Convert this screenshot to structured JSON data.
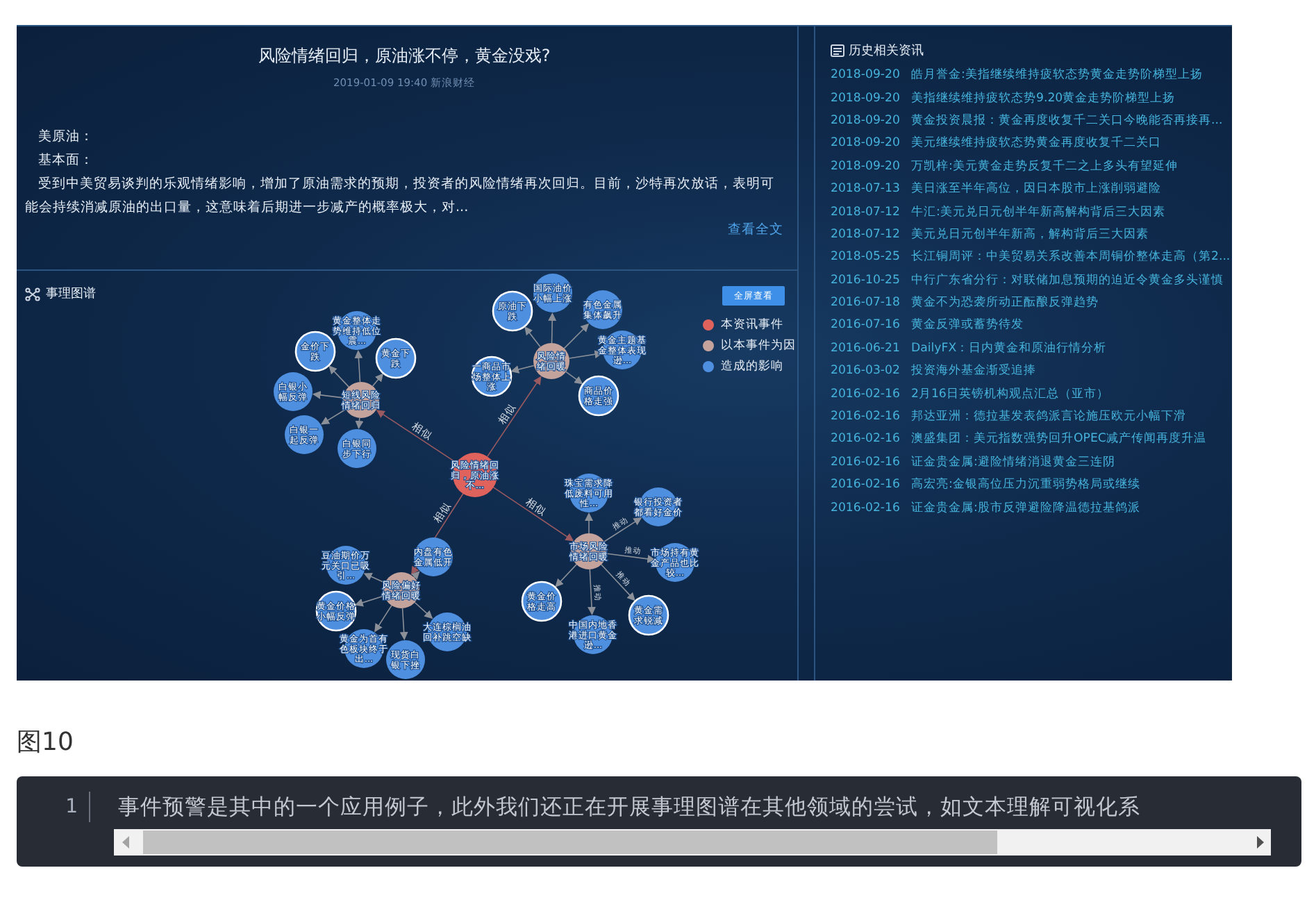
{
  "article": {
    "title": "风险情绪回归，原油涨不停，黄金没戏?",
    "meta": "2019-01-09 19:40 新浪财经",
    "lines": [
      "美原油：",
      "基本面：",
      "受到中美贸易谈判的乐观情绪影响，增加了原油需求的预期，投资者的风险情绪再次回归。目前，沙特再次放话，表明可能会持续消减原油的出口量，这意味着后期进一步减产的概率极大，对..."
    ],
    "read_more": "查看全文"
  },
  "graph": {
    "title": "事理图谱",
    "fullscreen_button": "全屏查看",
    "legend": [
      {
        "kind": "event",
        "label": "本资讯事件",
        "color": "#e0625c"
      },
      {
        "kind": "cause",
        "label": "以本事件为因",
        "color": "#c4a39c"
      },
      {
        "kind": "effect",
        "label": "造成的影响",
        "color": "#4f8fe0"
      }
    ],
    "root": {
      "label": "风险情绪回归，原油涨不...",
      "kind": "event",
      "children": [
        {
          "label": "短线风险情绪回归",
          "kind": "cause",
          "relation": "相似",
          "children": [
            {
              "label": "黄金整体走势维持低位震...",
              "kind": "effect",
              "highlighted": false
            },
            {
              "label": "金价下跌",
              "kind": "effect",
              "highlighted": true
            },
            {
              "label": "黄金下跌",
              "kind": "effect",
              "highlighted": true
            },
            {
              "label": "白银小幅反弹",
              "kind": "effect",
              "highlighted": false
            },
            {
              "label": "白银一起反弹",
              "kind": "effect",
              "highlighted": false
            },
            {
              "label": "白银同步下行",
              "kind": "effect",
              "highlighted": false
            }
          ]
        },
        {
          "label": "风险情绪回暖",
          "kind": "cause",
          "relation": "相似",
          "children": [
            {
              "label": "原油下跌",
              "kind": "effect",
              "highlighted": true
            },
            {
              "label": "国际油价小幅上涨",
              "kind": "effect",
              "highlighted": false
            },
            {
              "label": "有色金属集体飙升",
              "kind": "effect",
              "highlighted": false
            },
            {
              "label": "黄金主题基金整体表现逊...",
              "kind": "effect",
              "highlighted": false
            },
            {
              "label": "一商品市场整体上涨",
              "kind": "effect",
              "highlighted": true
            },
            {
              "label": "商品价格走强",
              "kind": "effect",
              "highlighted": true
            }
          ]
        },
        {
          "label": "市场风险情绪回暖",
          "kind": "cause",
          "relation": "相似",
          "children": [
            {
              "label": "珠宝需求降低废料可用性...",
              "kind": "effect",
              "highlighted": false
            },
            {
              "label": "银行投资者都看好金价",
              "kind": "effect",
              "highlighted": false,
              "relation": "推动"
            },
            {
              "label": "市场持有黄金产品也比较...",
              "kind": "effect",
              "highlighted": false,
              "relation": "推动"
            },
            {
              "label": "黄金需求锐减",
              "kind": "effect",
              "highlighted": true,
              "relation": "推动"
            },
            {
              "label": "中国内地香港进口黄金逊...",
              "kind": "effect",
              "highlighted": false,
              "relation": "推动"
            },
            {
              "label": "黄金价格走高",
              "kind": "effect",
              "highlighted": true
            }
          ]
        },
        {
          "label": "风险偏好情绪回暖",
          "kind": "cause",
          "relation": "相似",
          "children": [
            {
              "label": "豆油期价万元关口已吸引...",
              "kind": "effect",
              "highlighted": false
            },
            {
              "label": "内盘有色金属低开",
              "kind": "effect",
              "highlighted": false
            },
            {
              "label": "黄金价格小幅反弹",
              "kind": "effect",
              "highlighted": true
            },
            {
              "label": "黄金为首有色板块终于出...",
              "kind": "effect",
              "highlighted": false
            },
            {
              "label": "现货白银下挫",
              "kind": "effect",
              "highlighted": false
            },
            {
              "label": "大连棕榈油回补跳空缺",
              "kind": "effect",
              "highlighted": false
            }
          ]
        }
      ]
    }
  },
  "history": {
    "title": "历史相关资讯",
    "items": [
      {
        "date": "2018-09-20",
        "title": "皓月誉金:美指继续维持疲软态势黄金走势阶梯型上扬"
      },
      {
        "date": "2018-09-20",
        "title": "美指继续维持疲软态势9.20黄金走势阶梯型上扬"
      },
      {
        "date": "2018-09-20",
        "title": "黄金投资晨报：黄金再度收复千二关口今晚能否再接再..."
      },
      {
        "date": "2018-09-20",
        "title": "美元继续维持疲软态势黄金再度收复千二关口"
      },
      {
        "date": "2018-09-20",
        "title": "万凯梓:美元黄金走势反复千二之上多头有望延伸"
      },
      {
        "date": "2018-07-13",
        "title": "美日涨至半年高位，因日本股市上涨削弱避险"
      },
      {
        "date": "2018-07-12",
        "title": "牛汇:美元兑日元创半年新高解构背后三大因素"
      },
      {
        "date": "2018-07-12",
        "title": "美元兑日元创半年新高，解构背后三大因素"
      },
      {
        "date": "2018-05-25",
        "title": "长江铜周评：中美贸易关系改善本周铜价整体走高（第2..."
      },
      {
        "date": "2016-10-25",
        "title": "中行广东省分行：对联储加息预期的迫近令黄金多头谨慎"
      },
      {
        "date": "2016-07-18",
        "title": "黄金不为恐袭所动正酝酿反弹趋势"
      },
      {
        "date": "2016-07-16",
        "title": "黄金反弹或蓄势待发"
      },
      {
        "date": "2016-06-21",
        "title": "DailyFX：日内黄金和原油行情分析"
      },
      {
        "date": "2016-03-02",
        "title": "投资海外基金渐受追捧"
      },
      {
        "date": "2016-02-16",
        "title": "2月16日英镑机构观点汇总（亚市）"
      },
      {
        "date": "2016-02-16",
        "title": "邦达亚洲：德拉基发表鸽派言论施压欧元小幅下滑"
      },
      {
        "date": "2016-02-16",
        "title": "澳盛集团：美元指数强势回升OPEC减产传闻再度升温"
      },
      {
        "date": "2016-02-16",
        "title": "证金贵金属:避险情绪消退黄金三连阴"
      },
      {
        "date": "2016-02-16",
        "title": "高宏亮:金银高位压力沉重弱势格局或继续"
      },
      {
        "date": "2016-02-16",
        "title": "证金贵金属:股市反弹避险降温德拉基鸽派"
      }
    ]
  },
  "figure_caption": "图10",
  "code": {
    "line_number": "1",
    "text": "事件预警是其中的一个应用例子，此外我们还正在开展事理图谱在其他领域的尝试，如文本理解可视化系"
  }
}
